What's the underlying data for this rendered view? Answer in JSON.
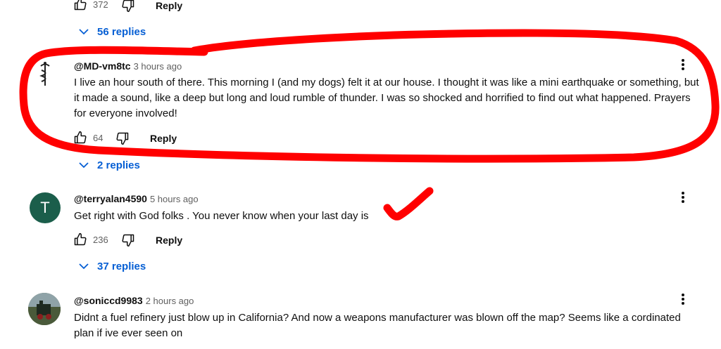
{
  "top_comment": {
    "likes": "372",
    "reply_label": "Reply",
    "replies_label": "56 replies"
  },
  "comments": [
    {
      "handle": "@MD-vm8tc",
      "time": "3 hours ago",
      "text": "I live an hour south of there. This morning I (and my dogs) felt it at our house. I thought it was like a mini earthquake or something, but it made a sound, like a deep but long and loud rumble of thunder. I was so shocked and horrified to find out what happened. Prayers for everyone involved!",
      "likes": "64",
      "reply_label": "Reply",
      "replies_label": "2 replies"
    },
    {
      "handle": "@terryalan4590",
      "time": "5 hours ago",
      "avatar_letter": "T",
      "text": "Get right with God folks . You never know when your last day is",
      "likes": "236",
      "reply_label": "Reply",
      "replies_label": "37 replies"
    },
    {
      "handle": "@soniccd9983",
      "time": "2 hours ago",
      "text": "Didnt a fuel refinery just blow up in California? And now a weapons manufacturer was blown off the map? Seems like a cordinated plan if ive ever seen on"
    }
  ],
  "colors": {
    "link_blue": "#065fd4",
    "annotation_red": "#ff0000",
    "avatar_green": "#1b5e4b",
    "muted": "#606060"
  },
  "icons": [
    "thumbs-up-icon",
    "thumbs-down-icon",
    "chevron-down-icon",
    "more-vert-icon"
  ]
}
